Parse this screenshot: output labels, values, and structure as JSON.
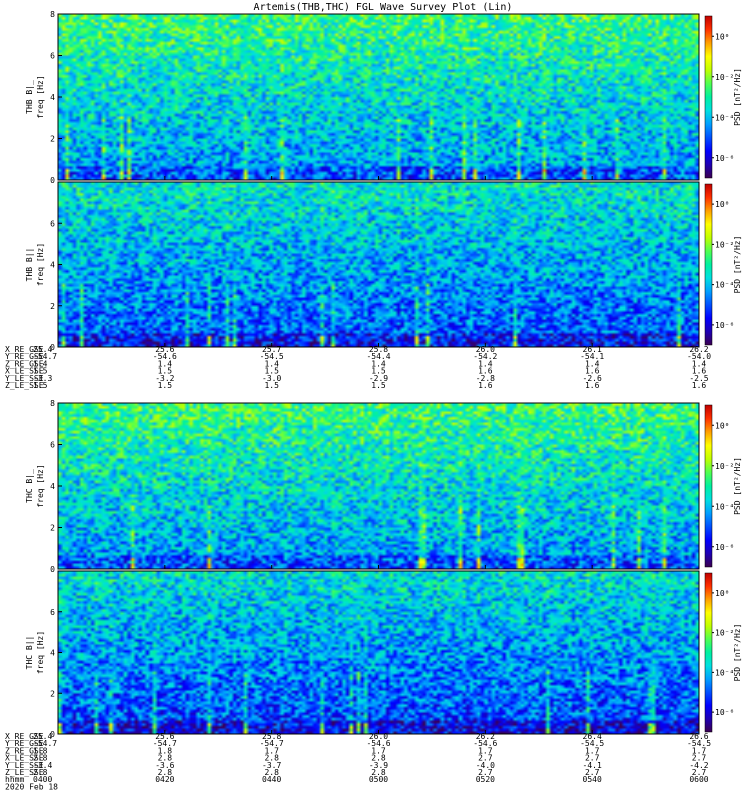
{
  "chart_data": {
    "type": "heatmap",
    "title": "Artemis(THB,THC) FGL Wave Survey Plot (Lin)",
    "colormap": [
      "#3b0050",
      "#1e00b4",
      "#0000ff",
      "#0050ff",
      "#00a0ff",
      "#00e0e0",
      "#00f0a0",
      "#50ff50",
      "#c0ff00",
      "#ffff00",
      "#ffa000",
      "#ff3000",
      "#c00000"
    ],
    "blocks": [
      {
        "panels": [
          {
            "probe_label": "THB B|_",
            "ylabel": "freq [Hz]",
            "y_ticks": [
              "0",
              "2",
              "4",
              "6",
              "8"
            ],
            "ylim": [
              0,
              8
            ],
            "colorbar_label": "PSD [nT²/Hz]",
            "colorbar_ticks": [
              "10⁰",
              "10⁻²",
              "10⁻⁴",
              "10⁻⁶"
            ],
            "colorbar_exponents": [
              0,
              -2,
              -4,
              -6
            ],
            "zlim_exp": [
              -7,
              1
            ],
            "bright": 0.5,
            "seed": 11
          },
          {
            "probe_label": "THB B||",
            "ylabel": "freq [Hz]",
            "y_ticks": [
              "0",
              "2",
              "4",
              "6"
            ],
            "ylim": [
              0,
              8
            ],
            "colorbar_label": "PSD [nT²/Hz]",
            "colorbar_ticks": [
              "10⁰",
              "10⁻²",
              "10⁻⁴",
              "10⁻⁶"
            ],
            "colorbar_exponents": [
              0,
              -2,
              -4,
              -6
            ],
            "zlim_exp": [
              -7,
              1
            ],
            "bright": 0.42,
            "seed": 23
          }
        ],
        "ephem_labels": [
          "X_RE_GSE",
          "Y_RE_GSE",
          "Z_RE_GSE",
          "X_LE_SSE",
          "Y_LE_SSE",
          "Z_LE_SSE"
        ],
        "ephem_columns": [
          [
            "25.4",
            "-54.7",
            "1.4",
            "1.5",
            "-3.3",
            "1.5"
          ],
          [
            "25.6",
            "-54.6",
            "1.4",
            "1.5",
            "-3.2",
            "1.5"
          ],
          [
            "25.7",
            "-54.5",
            "1.4",
            "1.5",
            "-3.0",
            "1.5"
          ],
          [
            "25.8",
            "-54.4",
            "1.4",
            "1.5",
            "-2.9",
            "1.5"
          ],
          [
            "26.0",
            "-54.2",
            "1.4",
            "1.6",
            "-2.8",
            "1.6"
          ],
          [
            "26.1",
            "-54.1",
            "1.4",
            "1.6",
            "-2.6",
            "1.6"
          ],
          [
            "26.2",
            "-54.0",
            "1.4",
            "1.6",
            "-2.5",
            "1.6"
          ]
        ]
      },
      {
        "panels": [
          {
            "probe_label": "THC B|_",
            "ylabel": "freq [Hz]",
            "y_ticks": [
              "0",
              "2",
              "4",
              "6",
              "8"
            ],
            "ylim": [
              0,
              8
            ],
            "colorbar_label": "PSD [nT²/Hz]",
            "colorbar_ticks": [
              "10⁰",
              "10⁻²",
              "10⁻⁴",
              "10⁻⁶"
            ],
            "colorbar_exponents": [
              0,
              -2,
              -4,
              -6
            ],
            "zlim_exp": [
              -7,
              1
            ],
            "bright": 0.5,
            "seed": 37
          },
          {
            "probe_label": "THC B||",
            "ylabel": "freq [Hz]",
            "y_ticks": [
              "0",
              "2",
              "4",
              "6"
            ],
            "ylim": [
              0,
              8
            ],
            "colorbar_label": "PSD [nT²/Hz]",
            "colorbar_ticks": [
              "10⁰",
              "10⁻²",
              "10⁻⁴",
              "10⁻⁶"
            ],
            "colorbar_exponents": [
              0,
              -2,
              -4,
              -6
            ],
            "zlim_exp": [
              -7,
              1
            ],
            "bright": 0.4,
            "seed": 51
          }
        ],
        "ephem_labels": [
          "X_RE_GSE",
          "Y_RE_GSE",
          "Z_RE_GSE",
          "X_LE_SSE",
          "Y_LE_SSE",
          "Z_LE_SSE",
          "hhmm",
          "2020 Feb 18"
        ],
        "ephem_columns": [
          [
            "25.4",
            "-54.7",
            "1.8",
            "2.8",
            "-3.4",
            "2.8",
            "0400",
            ""
          ],
          [
            "25.6",
            "-54.7",
            "1.8",
            "2.8",
            "-3.6",
            "2.8",
            "0420",
            ""
          ],
          [
            "25.8",
            "-54.7",
            "1.7",
            "2.8",
            "-3.7",
            "2.8",
            "0440",
            ""
          ],
          [
            "26.0",
            "-54.6",
            "1.7",
            "2.8",
            "-3.9",
            "2.8",
            "0500",
            ""
          ],
          [
            "26.2",
            "-54.6",
            "1.7",
            "2.7",
            "-4.0",
            "2.7",
            "0520",
            ""
          ],
          [
            "26.4",
            "-54.5",
            "1.7",
            "2.7",
            "-4.1",
            "2.7",
            "0540",
            ""
          ],
          [
            "26.6",
            "-54.5",
            "1.7",
            "2.7",
            "-4.2",
            "2.7",
            "0600",
            ""
          ]
        ]
      }
    ]
  }
}
